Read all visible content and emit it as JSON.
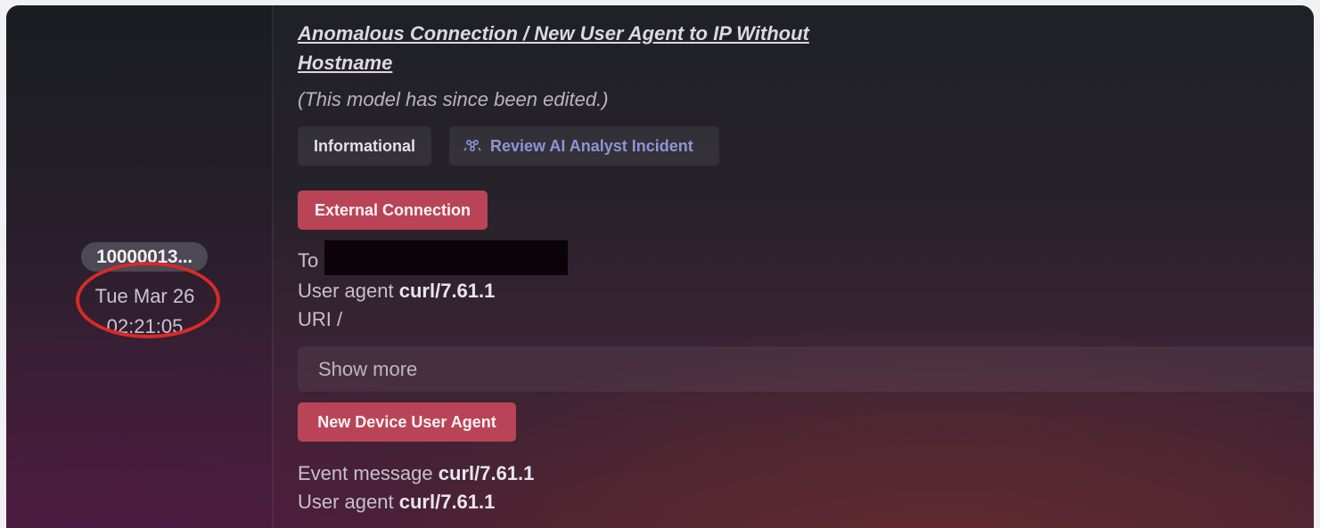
{
  "device": {
    "label": "10000013...",
    "date": "Tue Mar 26",
    "time": "02:21:05"
  },
  "model": {
    "title": "Anomalous Connection / New User Agent to IP Without Hostname",
    "edited_note": "(This model has since been edited.)"
  },
  "chips": {
    "severity": "Informational",
    "review": "Review AI Analyst Incident"
  },
  "sections": [
    {
      "tag": "External Connection",
      "details": [
        {
          "label": "To",
          "value": ""
        },
        {
          "label": "User agent",
          "value": "curl/7.61.1"
        },
        {
          "label": "URI",
          "value": "/"
        }
      ]
    },
    {
      "tag": "New Device User Agent",
      "details": [
        {
          "label": "Event message",
          "value": "curl/7.61.1"
        },
        {
          "label": "User agent",
          "value": "curl/7.61.1"
        }
      ]
    }
  ],
  "show_more": "Show more",
  "colors": {
    "tag_bg": "#b94457",
    "review_text": "#8d94d8",
    "annotation_circle": "#d62a2a"
  }
}
